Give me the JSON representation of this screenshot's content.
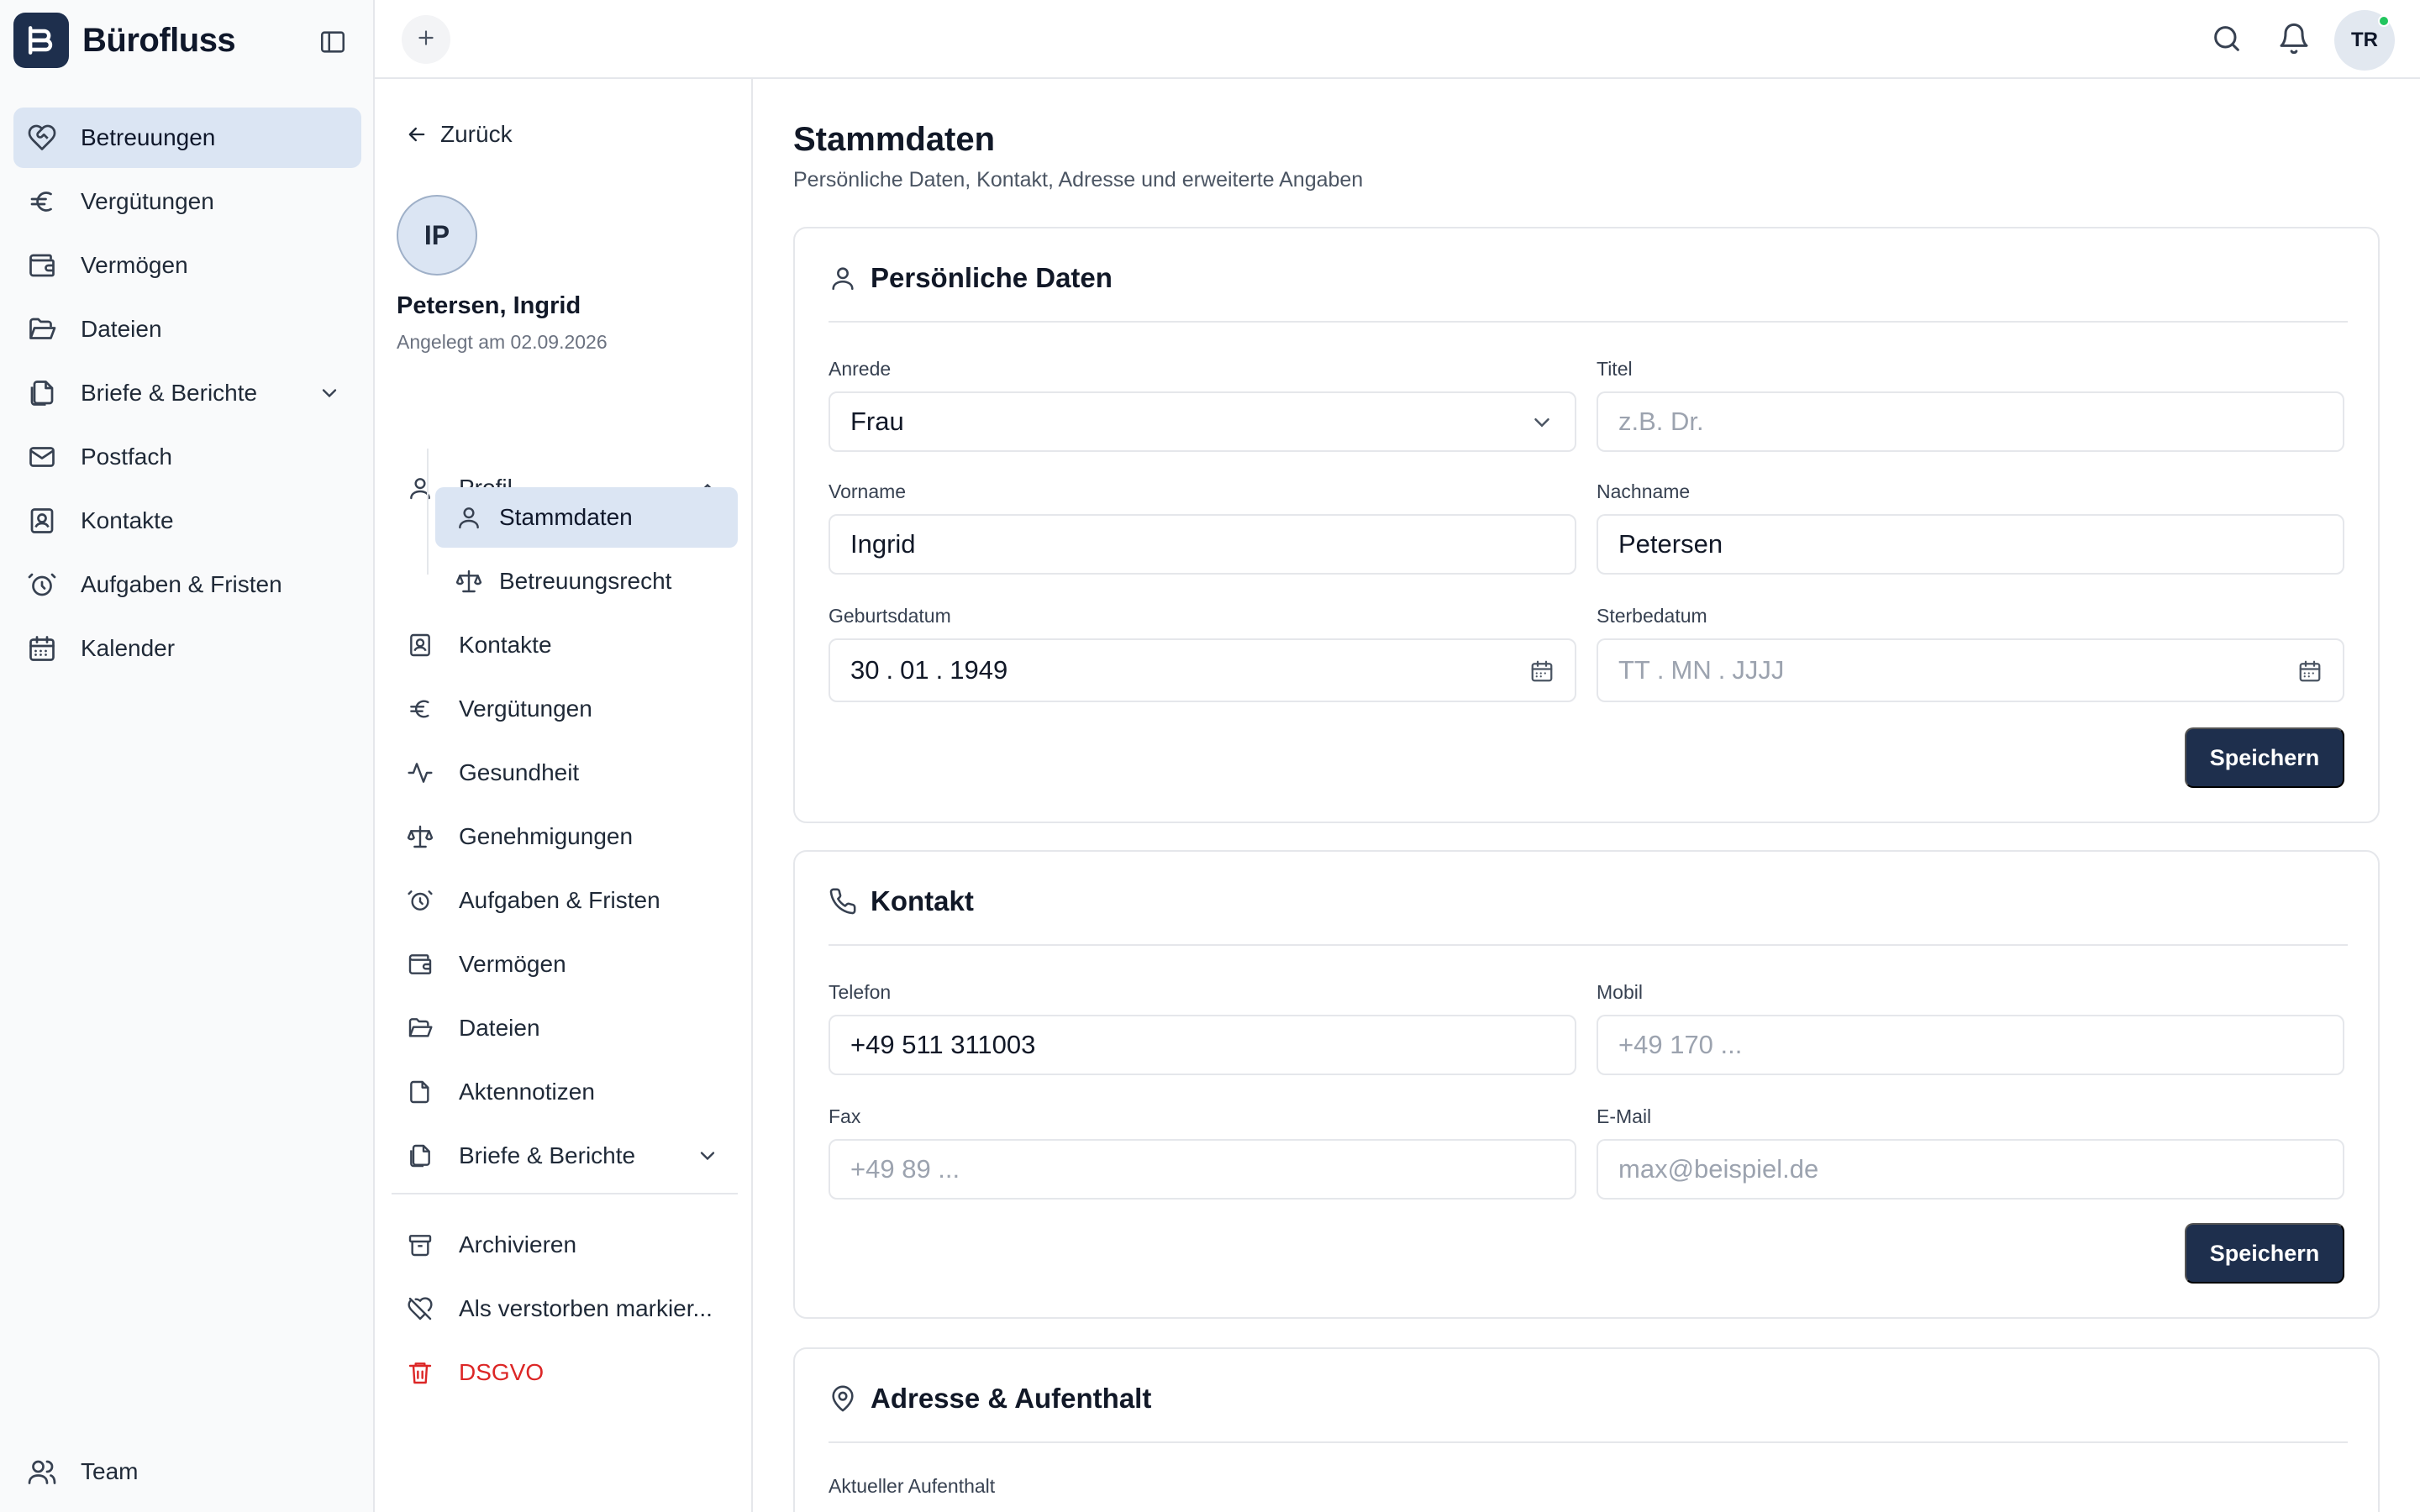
{
  "app": {
    "title": "Bürofluss",
    "brand_color": "#1e2f4d",
    "accent_soft": "#dbe5f3"
  },
  "sidebar": {
    "items": [
      {
        "label": "Betreuungen",
        "icon": "heart-handshake-icon",
        "active": true
      },
      {
        "label": "Vergütungen",
        "icon": "euro-icon"
      },
      {
        "label": "Vermögen",
        "icon": "wallet-icon"
      },
      {
        "label": "Dateien",
        "icon": "folder-open-icon"
      },
      {
        "label": "Briefe & Berichte",
        "icon": "files-icon",
        "expandable": true
      },
      {
        "label": "Postfach",
        "icon": "mail-icon"
      },
      {
        "label": "Kontakte",
        "icon": "contact-book-icon"
      },
      {
        "label": "Aufgaben & Fristen",
        "icon": "alarm-clock-icon"
      },
      {
        "label": "Kalender",
        "icon": "calendar-icon"
      }
    ],
    "team_label": "Team"
  },
  "topbar": {
    "avatar_initials": "TR"
  },
  "record": {
    "back_label": "Zurück",
    "avatar_initials": "IP",
    "name": "Petersen, Ingrid",
    "created": "Angelegt am 02.09.2026",
    "nav": {
      "profil": "Profil",
      "stammdaten": "Stammdaten",
      "betreuungsrecht": "Betreuungsrecht",
      "kontakte": "Kontakte",
      "verguetungen": "Vergütungen",
      "gesundheit": "Gesundheit",
      "genehmigungen": "Genehmigungen",
      "aufgaben": "Aufgaben & Fristen",
      "vermoegen": "Vermögen",
      "dateien": "Dateien",
      "aktennotizen": "Aktennotizen",
      "briefe": "Briefe & Berichte",
      "archivieren": "Archivieren",
      "verstorben": "Als verstorben markier...",
      "dsgvo": "DSGVO"
    }
  },
  "main": {
    "title": "Stammdaten",
    "subtitle": "Persönliche Daten, Kontakt, Adresse und erweiterte Angaben",
    "personal": {
      "heading": "Persönliche Daten",
      "anrede_label": "Anrede",
      "anrede_value": "Frau",
      "titel_label": "Titel",
      "titel_placeholder": "z.B. Dr.",
      "vorname_label": "Vorname",
      "vorname_value": "Ingrid",
      "nachname_label": "Nachname",
      "nachname_value": "Petersen",
      "geburt_label": "Geburtsdatum",
      "geburt_day": "30",
      "geburt_month": "01",
      "geburt_year": "1949",
      "sterbe_label": "Sterbedatum",
      "sterbe_day": "TT",
      "sterbe_month": "MN",
      "sterbe_year": "JJJJ",
      "save_label": "Speichern"
    },
    "contact": {
      "heading": "Kontakt",
      "telefon_label": "Telefon",
      "telefon_value": "+49 511 311003",
      "mobil_label": "Mobil",
      "mobil_placeholder": "+49 170 ...",
      "fax_label": "Fax",
      "fax_placeholder": "+49 89 ...",
      "email_label": "E-Mail",
      "email_placeholder": "max@beispiel.de",
      "save_label": "Speichern"
    },
    "address": {
      "heading": "Adresse & Aufenthalt",
      "aufenthalt_label": "Aktueller Aufenthalt"
    }
  }
}
